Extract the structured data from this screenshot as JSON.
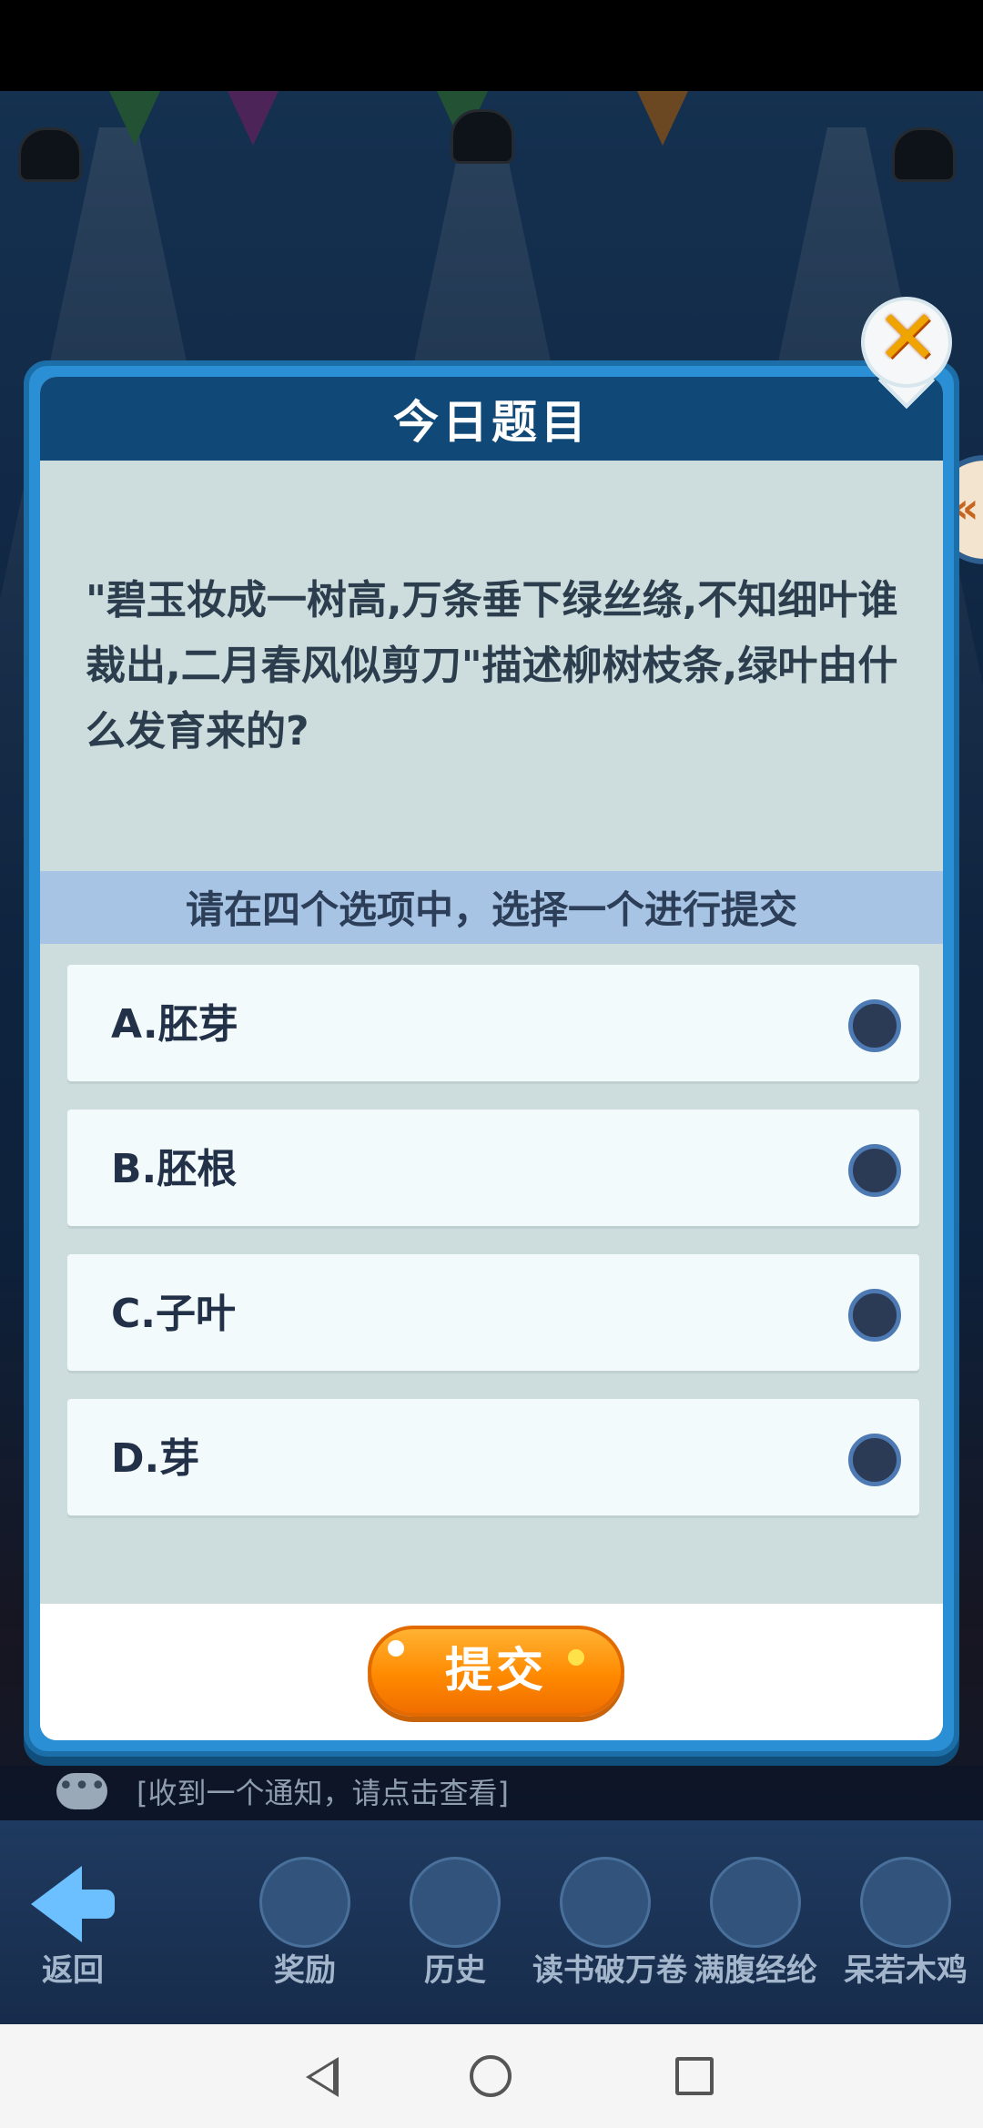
{
  "modal": {
    "title": "今日题目",
    "question": "\"碧玉妆成一树高,万条垂下绿丝绦,不知细叶谁裁出,二月春风似剪刀\"描述柳树枝条,绿叶由什么发育来的?",
    "instruction": "请在四个选项中，选择一个进行提交",
    "options": [
      {
        "label": "A.胚芽"
      },
      {
        "label": "B.胚根"
      },
      {
        "label": "C.子叶"
      },
      {
        "label": "D.芽"
      }
    ],
    "submit_label": "提交",
    "close_icon": "close-icon"
  },
  "side_tab": {
    "label": "«"
  },
  "notice": {
    "text": "[收到一个通知，请点击查看]"
  },
  "bottom_nav": {
    "items": [
      {
        "label": "返回"
      },
      {
        "label": "奖励"
      },
      {
        "label": "历史"
      },
      {
        "label": "读书破万卷"
      },
      {
        "label": "满腹经纶"
      },
      {
        "label": "呆若木鸡"
      }
    ]
  },
  "colors": {
    "header": "#104877",
    "modal_border": "#2a8fd4",
    "submit": "#ff8a00",
    "instruction_bar": "#a7c4e4"
  }
}
